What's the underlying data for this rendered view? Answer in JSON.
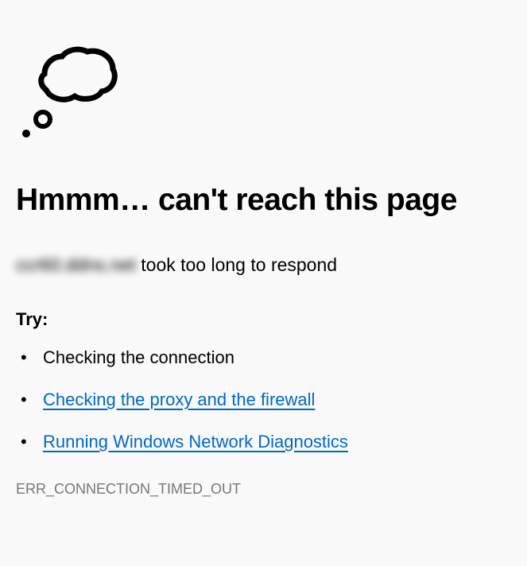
{
  "title": "Hmmm… can't reach this page",
  "subtitle": {
    "host": "ccr60.ddns.net",
    "message": " took too long to respond"
  },
  "try_label": "Try:",
  "suggestions": [
    {
      "text": "Checking the connection",
      "is_link": false
    },
    {
      "text": "Checking the proxy and the firewall",
      "is_link": true
    },
    {
      "text": "Running Windows Network Diagnostics",
      "is_link": true
    }
  ],
  "error_code": "ERR_CONNECTION_TIMED_OUT"
}
